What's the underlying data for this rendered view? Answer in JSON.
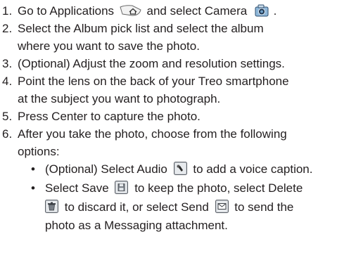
{
  "steps": [
    {
      "number": "1.",
      "text_before": "Go to Applications",
      "icon1": "applications-home-icon",
      "text_middle": "and select Camera",
      "icon2": "camera-icon",
      "text_after": "."
    },
    {
      "number": "2.",
      "line1": "Select the Album pick list and select the album",
      "line2": "where you want to save the photo."
    },
    {
      "number": "3.",
      "line1": "(Optional) Adjust the zoom and resolution settings."
    },
    {
      "number": "4.",
      "line1": "Point the lens on the back of your Treo smartphone",
      "line2": "at the subject you want to photograph."
    },
    {
      "number": "5.",
      "line1": "Press Center to capture the photo."
    },
    {
      "number": "6.",
      "line1": "After you take the photo, choose from the following",
      "line2": "options:"
    }
  ],
  "bullets": [
    {
      "symbol": "•",
      "text_before": "(Optional) Select Audio",
      "icon": "audio-icon",
      "text_after": "to add a voice caption."
    },
    {
      "symbol": "•",
      "line1_before": "Select Save",
      "save_icon": "save-icon",
      "line1_after": "to keep the photo, select Delete",
      "delete_icon": "delete-icon",
      "line2_middle": "to discard it, or select Send",
      "send_icon": "send-icon",
      "line2_after": "to send the",
      "line3": "photo as a Messaging attachment."
    }
  ]
}
